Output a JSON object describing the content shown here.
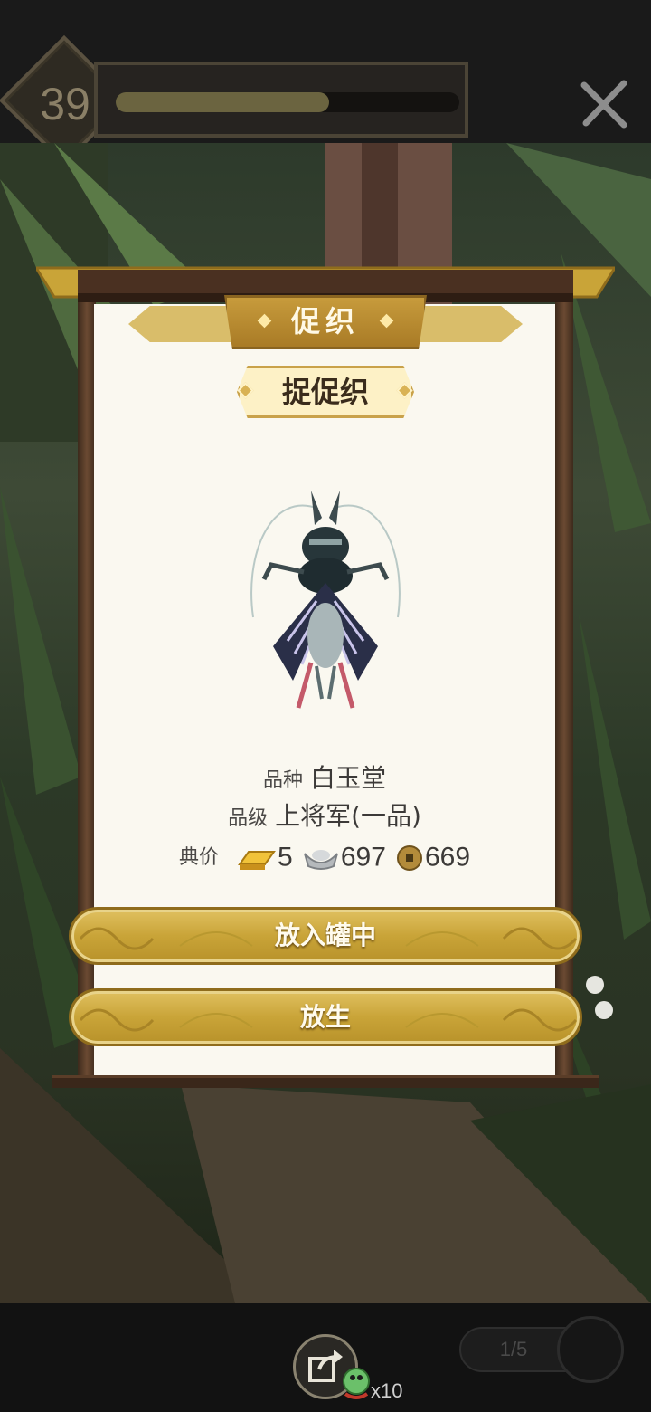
{
  "player": {
    "level": "39",
    "xp_progress": 0.62
  },
  "card": {
    "title": "促织",
    "subtitle": "捉促织",
    "insect_icon": "cricket-illustration",
    "species_label": "品种",
    "species_value": "白玉堂",
    "grade_label": "品级",
    "grade_value": "上将军(一品)",
    "price_label": "典价",
    "price": {
      "gold": "5",
      "gold_icon": "gold-bar-icon",
      "silver": "697",
      "silver_icon": "silver-ingot-icon",
      "copper": "669",
      "copper_icon": "copper-coin-icon"
    }
  },
  "buttons": {
    "put_in_jar": "放入罐中",
    "release": "放生"
  },
  "bottom": {
    "bait_count": "x10",
    "page": "1/5"
  },
  "colors": {
    "gold_button": "#c9a438",
    "paper": "#faf8f0",
    "frame_wood": "#3a271a"
  }
}
